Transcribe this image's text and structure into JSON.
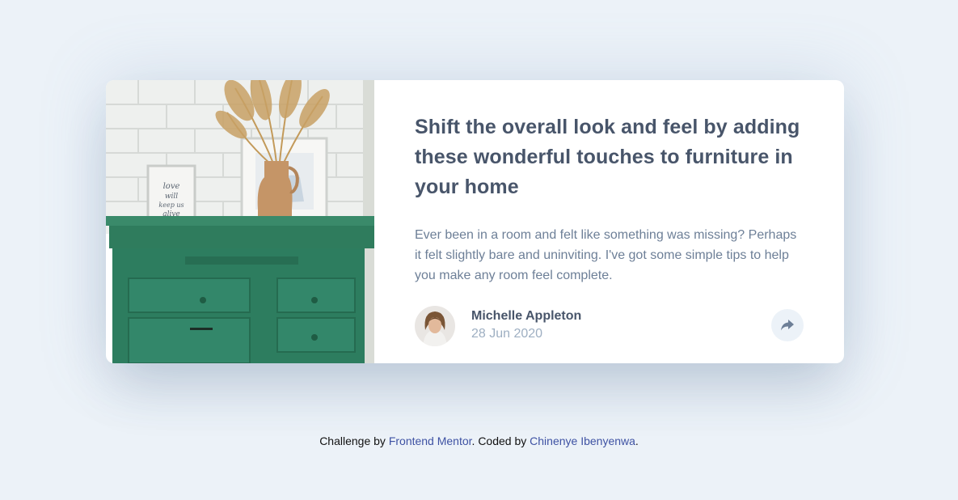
{
  "article": {
    "title": "Shift the overall look and feel by adding these wonderful touches to furniture in your home",
    "description": "Ever been in a room and felt like something was missing? Perhaps it felt slightly bare and uninviting. I've got some simple tips to help you make any room feel complete.",
    "frame_text": "love will keep us alive"
  },
  "author": {
    "name": "Michelle Appleton",
    "date": "28 Jun 2020"
  },
  "share": {
    "icon": "share-icon"
  },
  "footer": {
    "prefix": "Challenge by ",
    "link1": "Frontend Mentor",
    "middle": ". Coded by ",
    "link2": "Chinenye Ibenyenwa",
    "suffix": "."
  },
  "colors": {
    "background": "#ecf2f8",
    "heading": "#48556a",
    "body_text": "#6d7f97",
    "date_text": "#9eafc2",
    "link": "#3e52a3",
    "drawer_green": "#2d7d5f"
  }
}
